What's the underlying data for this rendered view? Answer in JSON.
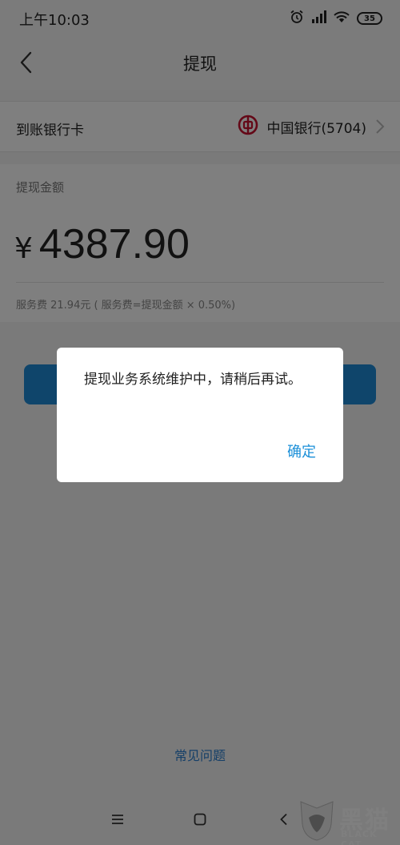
{
  "status_bar": {
    "time": "上午10:03",
    "battery": "35",
    "icons": [
      "alarm-icon",
      "signal-icon",
      "wifi-icon",
      "battery-icon"
    ]
  },
  "header": {
    "title": "提现",
    "back_icon": "chevron-left-icon"
  },
  "card_row": {
    "label": "到账银行卡",
    "bank_name": "中国银行(5704)",
    "bank_icon": "bank-of-china-logo"
  },
  "amount_section": {
    "label": "提现金额",
    "currency": "¥",
    "amount": "4387.90",
    "fee_text": "服务费 21.94元 ( 服务费=提现金额 × 0.50%)"
  },
  "submit_button": {
    "color": "#1e8ad6"
  },
  "faq_link": "常见问题",
  "dialog": {
    "message": "提现业务系统维护中，请稍后再试。",
    "ok_label": "确定"
  },
  "system_nav": {
    "icons": [
      "menu-icon",
      "home-icon",
      "back-icon"
    ]
  },
  "watermark": {
    "text": "黑猫",
    "subtext": "BLACK CAT"
  },
  "colors": {
    "accent": "#1a8fd8",
    "link": "#2a7fd0",
    "bank_red": "#c8102e"
  }
}
